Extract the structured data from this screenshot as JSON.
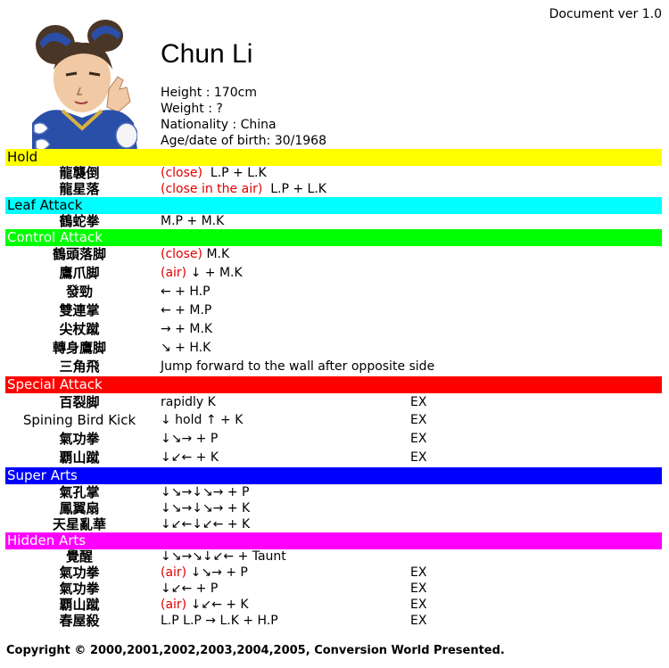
{
  "doc": {
    "version": "Document ver 1.0"
  },
  "character": {
    "name": "Chun Li",
    "height": "Height : 170cm",
    "weight": "Weight : ?",
    "nationality": "Nationality : China",
    "birth": "Age/date of birth: 30/1968"
  },
  "colors": {
    "hold": "#ffff00",
    "leaf": "#00ffff",
    "control": "#00ff00",
    "special": "#ff0000",
    "super": "#0000ff",
    "hidden": "#ff00ff",
    "accent_red": "#e00000"
  },
  "sections": {
    "hold": {
      "title": "Hold",
      "rows": [
        {
          "move": "龍襲倒",
          "pre": "(close)",
          "cmd": "L.P + L.K"
        },
        {
          "move": "龍星落",
          "pre": "(close in the air)",
          "cmd": "L.P + L.K"
        }
      ]
    },
    "leaf": {
      "title": "Leaf Attack",
      "rows": [
        {
          "move": "鶴蛇拳",
          "pre": "",
          "cmd": "M.P + M.K"
        }
      ]
    },
    "control": {
      "title": "Control Attack",
      "rows": [
        {
          "move": "鶴頭落脚",
          "pre": "(close)",
          "cmd": "M.K"
        },
        {
          "move": "鷹爪脚",
          "pre": "(air)",
          "cmd": "↓ + M.K"
        },
        {
          "move": "發勁",
          "pre": "",
          "cmd": "← + H.P"
        },
        {
          "move": "雙連掌",
          "pre": "",
          "cmd": "← + M.P"
        },
        {
          "move": "尖杖蹴",
          "pre": "",
          "cmd": "→ + M.K"
        },
        {
          "move": "轉身鷹脚",
          "pre": "",
          "cmd": "↘ + H.K"
        },
        {
          "move": "三角飛",
          "pre": "",
          "cmd": "Jump forward to the wall after opposite side"
        }
      ]
    },
    "special": {
      "title": "Special Attack",
      "rows": [
        {
          "move": "百裂脚",
          "cmd": "rapidly K",
          "ex": "EX"
        },
        {
          "move": "Spining Bird Kick",
          "cmd": "↓ hold  ↑ + K",
          "ex": "EX"
        },
        {
          "move": "氣功拳",
          "cmd": "↓↘→ + P",
          "ex": "EX"
        },
        {
          "move": "覇山蹴",
          "cmd": "↓↙← + K",
          "ex": "EX"
        }
      ]
    },
    "super": {
      "title": "Super Arts",
      "rows": [
        {
          "move": "氣孔掌",
          "cmd": "↓↘→↓↘→ + P"
        },
        {
          "move": "鳳翼扇",
          "cmd": "↓↘→↓↘→ + K"
        },
        {
          "move": "天星亂華",
          "cmd": "↓↙←↓↙← + K"
        }
      ]
    },
    "hidden": {
      "title": "Hidden Arts",
      "rows": [
        {
          "move": "覺醒",
          "pre": "",
          "cmd": "↓↘→↘↓↙← + Taunt",
          "ex": ""
        },
        {
          "move": "氣功拳",
          "pre": "(air)",
          "cmd": "↓↘→ + P",
          "ex": "EX"
        },
        {
          "move": "氣功拳",
          "pre": "",
          "cmd": "↓↙← + P",
          "ex": "EX"
        },
        {
          "move": "覇山蹴",
          "pre": "(air)",
          "cmd": "↓↙← + K",
          "ex": "EX"
        },
        {
          "move": "春屋殺",
          "pre": "",
          "cmd": "L.P L.P → L.K + H.P",
          "ex": "EX"
        }
      ]
    }
  },
  "footer": {
    "copyright": "Copyright © 2000,2001,2002,2003,2004,2005, Conversion World Presented."
  }
}
